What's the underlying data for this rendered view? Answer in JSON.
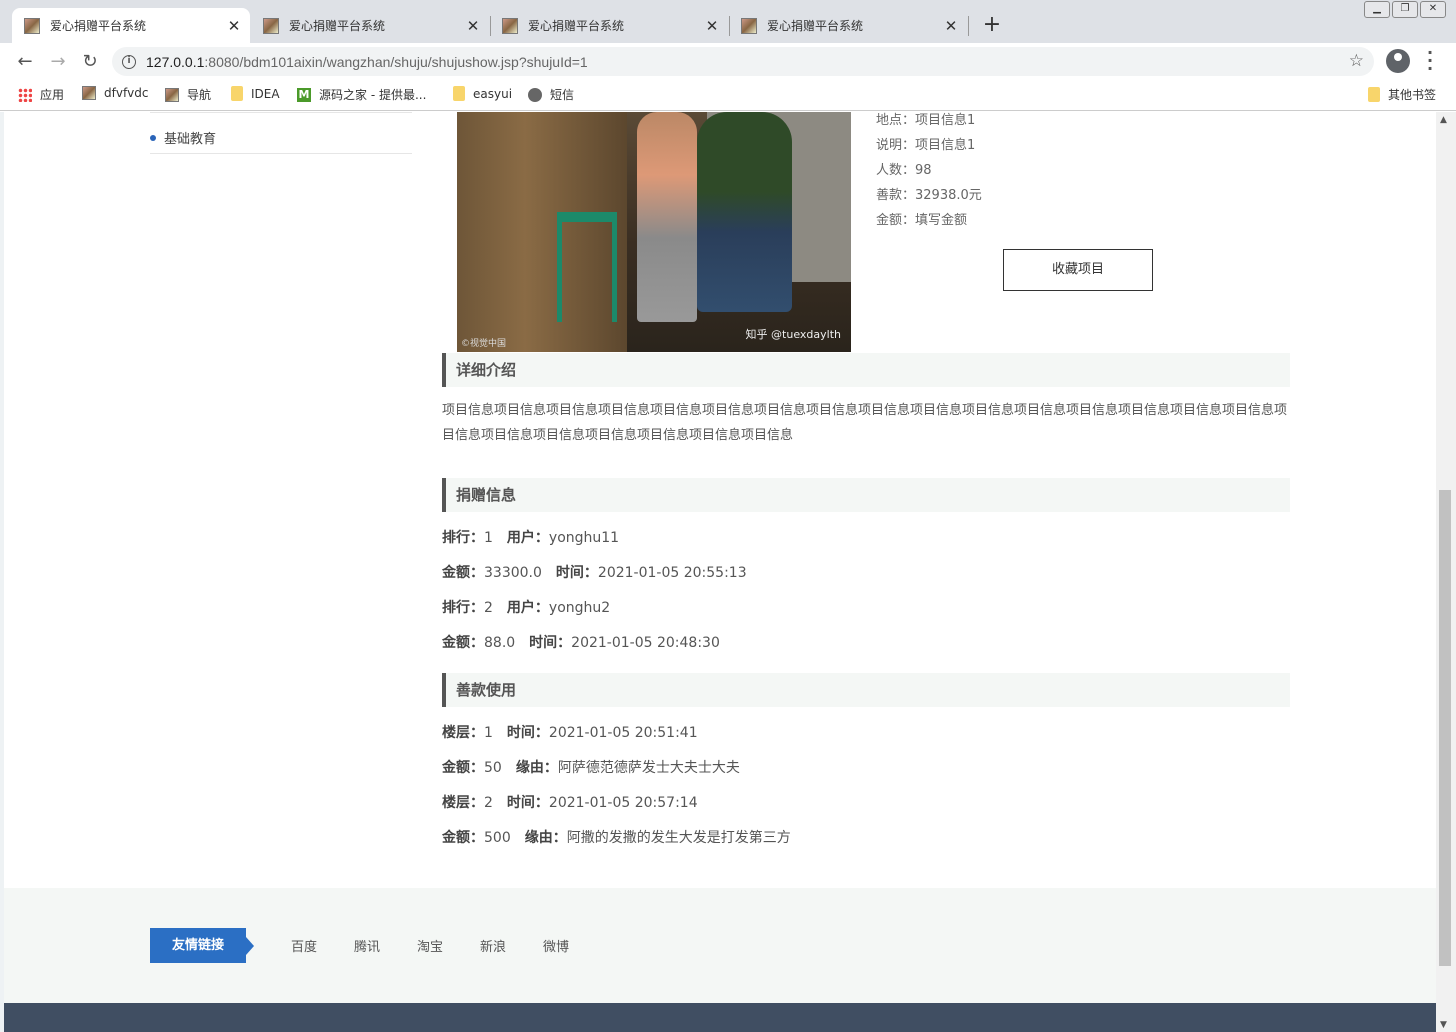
{
  "browser": {
    "tabs": [
      {
        "title": "爱心捐赠平台系统",
        "active": true
      },
      {
        "title": "爱心捐赠平台系统",
        "active": false
      },
      {
        "title": "爱心捐赠平台系统",
        "active": false
      },
      {
        "title": "爱心捐赠平台系统",
        "active": false
      }
    ],
    "url_host": "127.0.0.1",
    "url_rest": ":8080/bdm101aixin/wangzhan/shuju/shujushow.jsp?shujuId=1",
    "bookmarks": [
      "应用",
      "dfvfvdc",
      "导航",
      "IDEA",
      "源码之家 - 提供最...",
      "easyui",
      "短信"
    ],
    "other_bookmarks": "其他书签"
  },
  "sidebar": {
    "items": [
      {
        "label": "基础教育"
      }
    ]
  },
  "project": {
    "location": "地点：项目信息1",
    "description": "说明：项目信息1",
    "people": "人数：98",
    "donation": "善款：32938.0元",
    "amount": "金额：填写金额",
    "collect_label": "收藏项目",
    "photo_watermark_left": "©视觉中国",
    "photo_watermark_right": "知乎 @tuexdaylth"
  },
  "detail": {
    "title": "详细介绍",
    "text": "项目信息项目信息项目信息项目信息项目信息项目信息项目信息项目信息项目信息项目信息项目信息项目信息项目信息项目信息项目信息项目信息项目信息项目信息项目信息项目信息项目信息项目信息项目信息"
  },
  "donations": {
    "title": "捐赠信息",
    "rank_label": "排行：",
    "user_label": "用户：",
    "amount_label": "金额：",
    "time_label": "时间：",
    "records": [
      {
        "rank": "1",
        "user": "yonghu11",
        "amount": "33300.0",
        "time": "2021-01-05 20:55:13"
      },
      {
        "rank": "2",
        "user": "yonghu2",
        "amount": "88.0",
        "time": "2021-01-05 20:48:30"
      }
    ]
  },
  "usage": {
    "title": "善款使用",
    "floor_label": "楼层：",
    "time_label": "时间：",
    "amount_label": "金额：",
    "reason_label": "缘由：",
    "records": [
      {
        "floor": "1",
        "time": "2021-01-05 20:51:41",
        "amount": "50",
        "reason": "阿萨德范德萨发士大夫士大夫"
      },
      {
        "floor": "2",
        "time": "2021-01-05 20:57:14",
        "amount": "500",
        "reason": "阿撒的发撒的发生大发是打发第三方"
      }
    ]
  },
  "footer": {
    "friend_label": "友情链接",
    "links": [
      "百度",
      "腾讯",
      "淘宝",
      "新浪",
      "微博"
    ]
  },
  "colors": {
    "accent": "#2b6fc4",
    "footer_bar": "#404e62",
    "section_bg": "#f4f7f5"
  }
}
